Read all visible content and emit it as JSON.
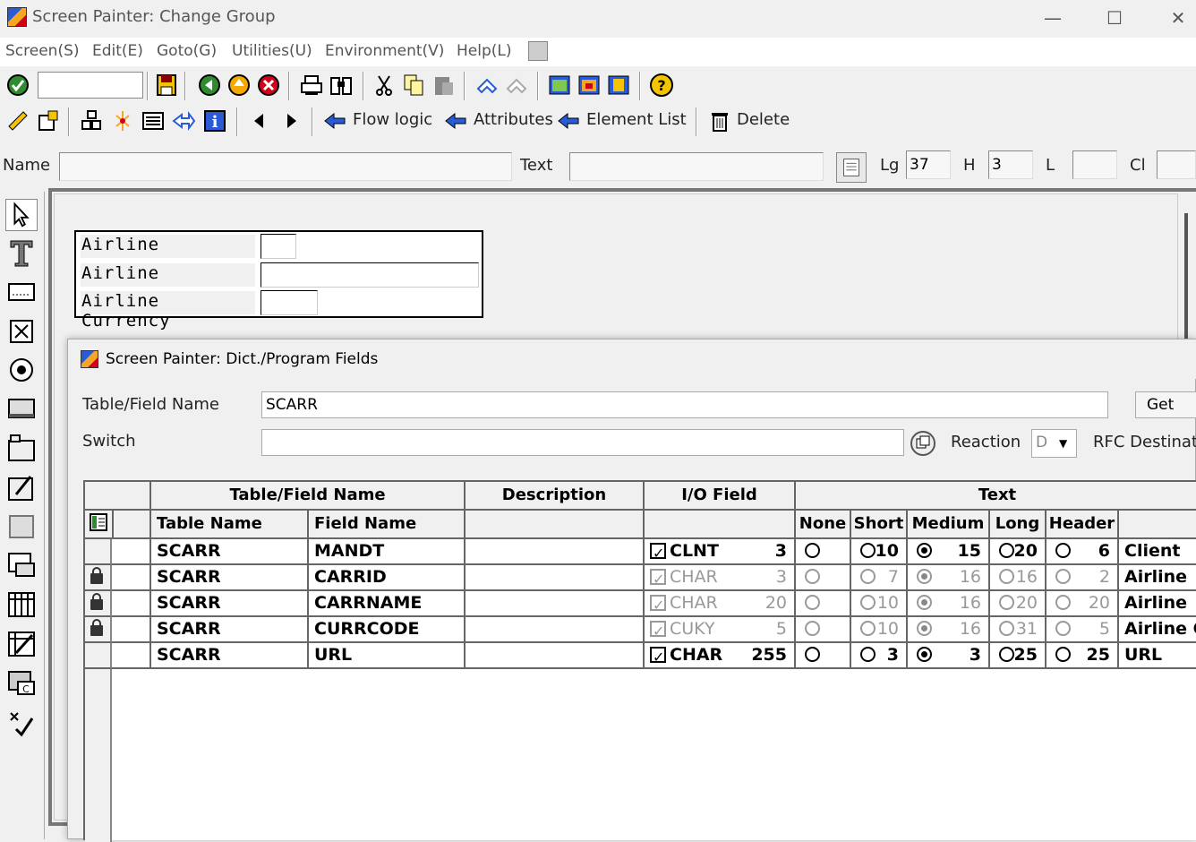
{
  "window": {
    "title": "Screen Painter:  Change Group",
    "minimize": "—",
    "maximize": "☐",
    "close": "✕"
  },
  "menu": [
    "Screen(S)",
    "Edit(E)",
    "Goto(G)",
    "Utilities(U)",
    "Environment(V)",
    "Help(L)"
  ],
  "toolbar2": {
    "flow_logic": "Flow logic",
    "attributes": "Attributes",
    "element_list": "Element List",
    "delete": "Delete"
  },
  "attrs": {
    "name_label": "Name",
    "name_value": "",
    "text_label": "Text",
    "text_value": "",
    "lg_label": "Lg",
    "lg_value": "37",
    "h_label": "H",
    "h_value": "3",
    "l_label": "L",
    "l_value": "",
    "cl_label": "Cl",
    "cl_value": ""
  },
  "screen_fields": [
    {
      "label": "Airline"
    },
    {
      "label": "Airline"
    },
    {
      "label": "Airline Currency"
    }
  ],
  "dialog": {
    "title": "Screen Painter: Dict./Program Fields",
    "table_field_label": "Table/Field Name",
    "table_field_value": "SCARR",
    "get_from_button": "Get fro",
    "switch_label": "Switch",
    "switch_value": "",
    "reaction_label": "Reaction",
    "reaction_value": "D",
    "rfc_label": "RFC Destinati"
  },
  "grid": {
    "group_headers": [
      "Table/Field Name",
      "Description",
      "I/O Field",
      "Text"
    ],
    "sub_headers": [
      "Table Name",
      "Field Name",
      "None",
      "Short",
      "Medium",
      "Long",
      "Header"
    ],
    "rows": [
      {
        "locked": false,
        "table": "SCARR",
        "field": "MANDT",
        "desc": "",
        "io_checked": true,
        "io_dim": false,
        "type": "CLNT",
        "len": "3",
        "short": "10",
        "medium": "15",
        "long": "20",
        "header": "6",
        "selected": "medium",
        "text": "Client",
        "dim": false
      },
      {
        "locked": true,
        "table": "SCARR",
        "field": "CARRID",
        "desc": "",
        "io_checked": true,
        "io_dim": true,
        "type": "CHAR",
        "len": "3",
        "short": "7",
        "medium": "16",
        "long": "16",
        "header": "2",
        "selected": "medium",
        "text": "Airline",
        "dim": true
      },
      {
        "locked": true,
        "table": "SCARR",
        "field": "CARRNAME",
        "desc": "",
        "io_checked": true,
        "io_dim": true,
        "type": "CHAR",
        "len": "20",
        "short": "10",
        "medium": "16",
        "long": "20",
        "header": "20",
        "selected": "medium",
        "text": "Airline",
        "dim": true
      },
      {
        "locked": true,
        "table": "SCARR",
        "field": "CURRCODE",
        "desc": "",
        "io_checked": true,
        "io_dim": true,
        "type": "CUKY",
        "len": "5",
        "short": "10",
        "medium": "16",
        "long": "31",
        "header": "5",
        "selected": "medium",
        "text": "Airline Cu",
        "dim": true
      },
      {
        "locked": false,
        "table": "SCARR",
        "field": "URL",
        "desc": "",
        "io_checked": true,
        "io_dim": false,
        "type": "CHAR",
        "len": "255",
        "short": "3",
        "medium": "3",
        "long": "25",
        "header": "25",
        "selected": "medium",
        "text": "URL",
        "dim": false
      }
    ]
  }
}
